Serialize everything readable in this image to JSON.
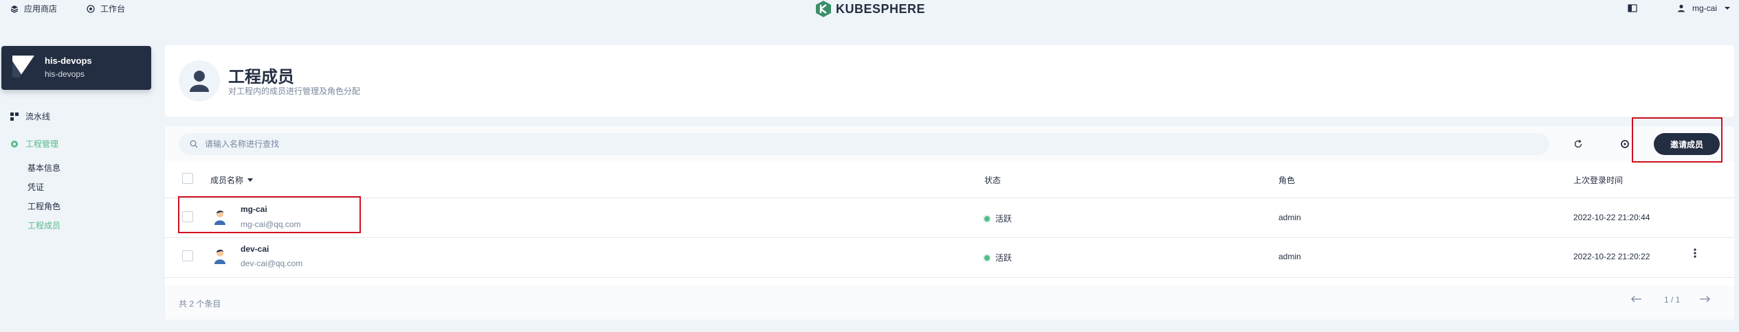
{
  "topbar": {
    "app_store": "应用商店",
    "workbench": "工作台",
    "brand": "KUBESPHERE",
    "username": "mg-cai"
  },
  "project": {
    "name": "his-devops",
    "subtitle": "his-devops"
  },
  "sidebar": {
    "pipeline": "流水线",
    "management": "工程管理",
    "sub_items": [
      "基本信息",
      "凭证",
      "工程角色",
      "工程成员"
    ]
  },
  "header": {
    "title": "工程成员",
    "description": "对工程内的成员进行管理及角色分配"
  },
  "toolbar": {
    "search_placeholder": "请输入名称进行查找",
    "invite_label": "邀请成员"
  },
  "table": {
    "columns": {
      "name": "成员名称",
      "status": "状态",
      "role": "角色",
      "last_login": "上次登录时间"
    },
    "rows": [
      {
        "name": "mg-cai",
        "email": "mg-cai@qq.com",
        "status": "活跃",
        "role": "admin",
        "last_login": "2022-10-22 21:20:44"
      },
      {
        "name": "dev-cai",
        "email": "dev-cai@qq.com",
        "status": "活跃",
        "role": "admin",
        "last_login": "2022-10-22 21:20:22"
      }
    ]
  },
  "footer": {
    "total": "共 2 个条目",
    "page": "1 / 1"
  },
  "colors": {
    "accent": "#55bc8a",
    "dark": "#242e42",
    "highlight": "#d0101e"
  }
}
